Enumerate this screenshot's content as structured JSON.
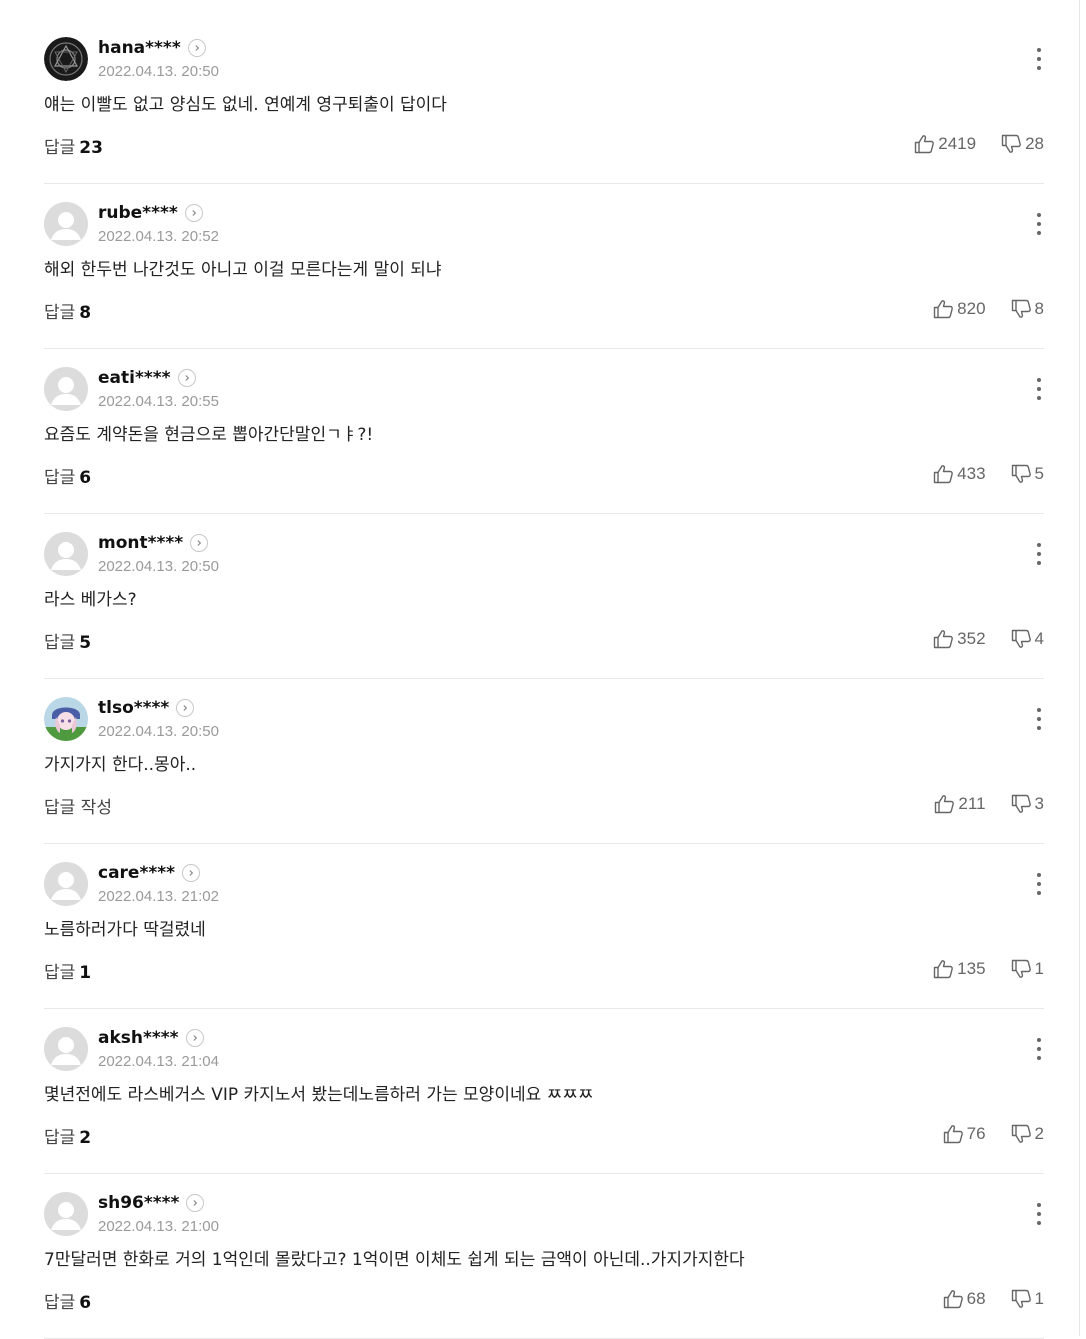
{
  "comments": [
    {
      "username": "hana****",
      "timestamp": "2022.04.13. 20:50",
      "text": "얘는 이빨도 없고 양심도 없네. 연예계 영구퇴출이 답이다",
      "reply_label": "답글",
      "reply_count": "23",
      "likes": "2419",
      "dislikes": "28",
      "avatar": "dark-emblem-avatar"
    },
    {
      "username": "rube****",
      "timestamp": "2022.04.13. 20:52",
      "text": "해외 한두번 나간것도 아니고 이걸 모른다는게 말이 되냐",
      "reply_label": "답글",
      "reply_count": "8",
      "likes": "820",
      "dislikes": "8",
      "avatar": "default-avatar"
    },
    {
      "username": "eati****",
      "timestamp": "2022.04.13. 20:55",
      "text": "요즘도 계약돈을 현금으로 뽑아간단말인ㄱㅑ?!",
      "reply_label": "답글",
      "reply_count": "6",
      "likes": "433",
      "dislikes": "5",
      "avatar": "default-avatar"
    },
    {
      "username": "mont****",
      "timestamp": "2022.04.13. 20:50",
      "text": "라스 베가스?",
      "reply_label": "답글",
      "reply_count": "5",
      "likes": "352",
      "dislikes": "4",
      "avatar": "default-avatar"
    },
    {
      "username": "tlso****",
      "timestamp": "2022.04.13. 20:50",
      "text": "가지가지 한다..몽아..",
      "reply_label": "답글 작성",
      "reply_count": "",
      "likes": "211",
      "dislikes": "3",
      "avatar": "character-avatar"
    },
    {
      "username": "care****",
      "timestamp": "2022.04.13. 21:02",
      "text": "노름하러가다 딱걸렸네",
      "reply_label": "답글",
      "reply_count": "1",
      "likes": "135",
      "dislikes": "1",
      "avatar": "default-avatar"
    },
    {
      "username": "aksh****",
      "timestamp": "2022.04.13. 21:04",
      "text": "몇년전에도 라스베거스 VIP 카지노서 봤는데노름하러 가는 모양이네요 ㅉㅉㅉ",
      "reply_label": "답글",
      "reply_count": "2",
      "likes": "76",
      "dislikes": "2",
      "avatar": "default-avatar"
    },
    {
      "username": "sh96****",
      "timestamp": "2022.04.13. 21:00",
      "text": "7만달러면 한화로 거의 1억인데 몰랐다고? 1억이면 이체도 쉽게 되는 금액이 아닌데..가지가지한다",
      "reply_label": "답글",
      "reply_count": "6",
      "likes": "68",
      "dislikes": "1",
      "avatar": "default-avatar"
    }
  ],
  "icons": {
    "like": "thumbs-up-icon",
    "dislike": "thumbs-down-icon",
    "more": "more-vertical-icon",
    "profile": "chevron-right-icon"
  },
  "colors": {
    "username": "#111111",
    "timestamp": "#9a9a9a",
    "text": "#222222",
    "vote_count": "#666666",
    "divider": "#e9e9e9"
  }
}
